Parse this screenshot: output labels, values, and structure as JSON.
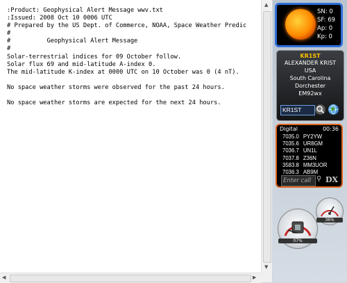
{
  "document": {
    "lines": [
      ":Product: Geophysical Alert Message wwv.txt",
      ":Issued: 2008 Oct 10 0006 UTC",
      "# Prepared by the US Dept. of Commerce, NOAA, Space Weather Predic",
      "#",
      "#          Geophysical Alert Message",
      "#",
      "Solar-terrestrial indices for 09 October follow.",
      "Solar flux 69 and mid-latitude A-index 0.",
      "The mid-latitude K-index at 0000 UTC on 10 October was 0 (4 nT).",
      "",
      "No space weather storms were observed for the past 24 hours.",
      "",
      "No space weather storms are expected for the next 24 hours."
    ]
  },
  "solar_gadget": {
    "sn": "SN: 0",
    "sf": "SF: 69",
    "ap": "Ap: 0",
    "kp": "Kp: 0"
  },
  "callbook": {
    "header": "KR1ST",
    "name": "ALEXANDER KRIST",
    "country": "USA",
    "state": "South Carolina",
    "county": "Dorchester",
    "grid": "EM92wx",
    "callsign_input": "KR1ST"
  },
  "dx_cluster": {
    "mode": "Digital",
    "time": "00:36",
    "spots": [
      {
        "freq": "7035.0",
        "call": "PY2YW"
      },
      {
        "freq": "7035.6",
        "call": "UR8GM"
      },
      {
        "freq": "7036.7",
        "call": "UN1L"
      },
      {
        "freq": "7037.8",
        "call": "Z36N"
      },
      {
        "freq": "3583.8",
        "call": "MM3UOR"
      },
      {
        "freq": "7036.3",
        "call": "AB9M"
      }
    ],
    "call_placeholder": "Enter call",
    "dx_label": "DX"
  },
  "meters": {
    "cpu_label": "07%",
    "mem_label": "36%"
  }
}
